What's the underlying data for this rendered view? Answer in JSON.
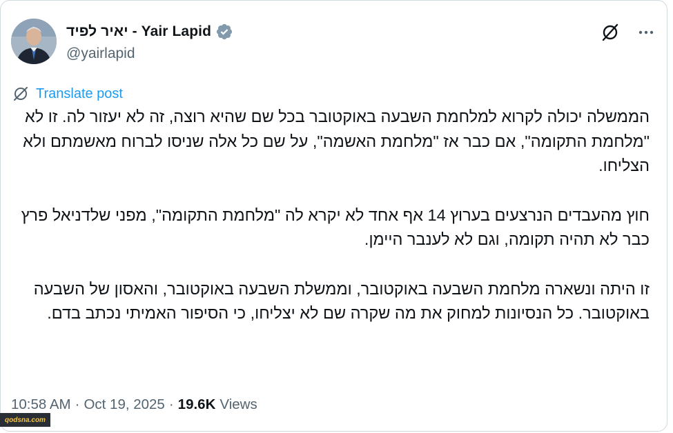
{
  "author": {
    "display_name": "יאיר לפיד - Yair Lapid",
    "handle": "@yairlapid",
    "verified": true
  },
  "actions": {
    "grok_icon": "slash-circle-icon",
    "more_icon": "more-dots-icon"
  },
  "translate": {
    "label": "Translate post"
  },
  "post": {
    "paragraphs": [
      "הממשלה יכולה לקרוא למלחמת השבעה באוקטובר בכל שם שהיא רוצה, זה לא יעזור לה. זו לא \"מלחמת התקומה\", אם כבר אז \"מלחמת האשמה\", על שם כל אלה שניסו לברוח מאשמתם ולא הצליחו.",
      "חוץ מהעבדים הנרצעים בערוץ 14 אף אחד לא יקרא לה \"מלחמת התקומה\", מפני שלדניאל פרץ כבר לא תהיה תקומה, וגם לא לענבר היימן.",
      "זו היתה ונשארה מלחמת השבעה באוקטובר, וממשלת השבעה באוקטובר, והאסון של השבעה באוקטובר. כל הנסיונות למחוק את מה שקרה שם לא יצליחו, כי הסיפור האמיתי נכתב בדם."
    ]
  },
  "meta": {
    "time": "10:58 AM",
    "separator": "·",
    "date": "Oct 19, 2025",
    "views_count": "19.6K",
    "views_label": "Views"
  },
  "watermark": {
    "text": "qodsna.com"
  },
  "colors": {
    "accent": "#1d9bf0",
    "secondary_text": "#536471",
    "primary_text": "#0f1419"
  }
}
